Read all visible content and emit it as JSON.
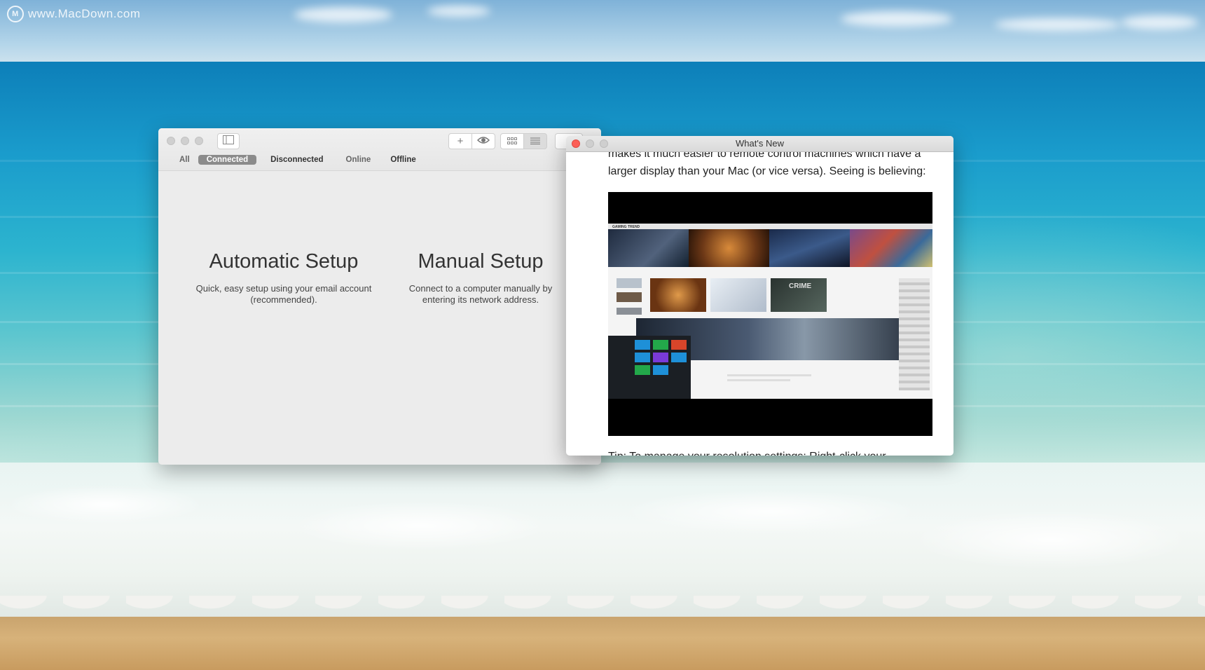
{
  "watermark": {
    "logo_letter": "M",
    "text": "www.MacDown.com"
  },
  "main_window": {
    "toolbar": {
      "sidebar_icon": "sidebar-toggle-icon",
      "add_label": "+",
      "view_icon": "eye-icon",
      "grid_icon": "grid-view-icon",
      "list_icon": "list-view-icon",
      "sort_label": "▾"
    },
    "filters": [
      {
        "label": "All"
      },
      {
        "label": "Connected",
        "selected": true
      },
      {
        "label": "Disconnected"
      },
      {
        "label": "Online"
      },
      {
        "label": "Offline"
      }
    ],
    "automatic": {
      "title": "Automatic Setup",
      "desc_line1": "Quick, easy setup using your email account",
      "desc_line2": "(recommended)."
    },
    "manual": {
      "title": "Manual Setup",
      "desc_line1": "Connect to a computer manually by",
      "desc_line2": "entering its network address."
    }
  },
  "whats_new": {
    "title": "What's New",
    "text_line1": "makes it much easier to remote control machines which have a",
    "text_line2": "larger display than your Mac (or vice versa). Seeing is believing:",
    "tip": "Tip: To manage your resolution settings: Right-click your",
    "screenshot": {
      "logo": "GAMING TREND",
      "crime_label": "CRIME"
    }
  },
  "colors": {
    "close": "#fc5f57",
    "filter_selected_bg": "#8b8b8b"
  }
}
